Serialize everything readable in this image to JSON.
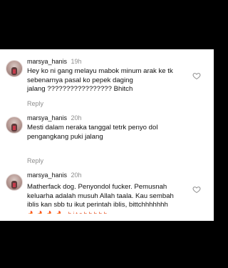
{
  "comments": [
    {
      "username": "marsya_hanis",
      "time": "19h",
      "text": "Hey ko ni gang melayu mabok minum arak ke tk\nsebenarnya pasal ko pepek daging\njalang ????????????????? Bhitch",
      "reply_label": "Reply"
    },
    {
      "username": "marsya_hanis",
      "time": "20h",
      "text": "Mesti dalam neraka tanggal tetrk penyo dol\npengangkang puki jalang",
      "reply_label": "Reply"
    },
    {
      "username": "marsya_hanis",
      "time": "20h",
      "text": "Matherfack dog. Penyondol fucker. Pemusnah\nkeluarha adalah musuh Allah taala. Kau sembah\niblis kan sbb tu ikut perintah iblis, bittchhhhhhh",
      "emoji_row": "🔥🔥🔥🔥 bitchhhhh"
    }
  ],
  "icons": {
    "like": "heart-outline-icon",
    "avatar": "profile-photo"
  },
  "colors": {
    "background": "#000000",
    "panel": "#ffffff",
    "text": "#111111",
    "muted": "#8e8e8e"
  }
}
